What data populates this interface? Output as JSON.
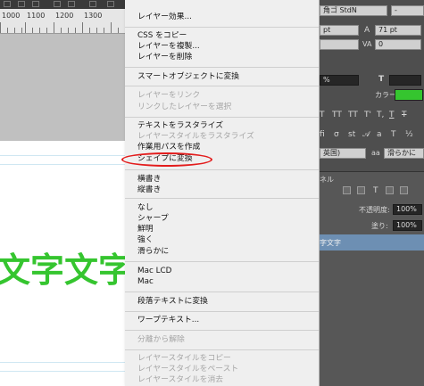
{
  "canvas": {
    "ruler_labels": [
      "1000",
      "1100",
      "1200",
      "1300"
    ],
    "big_text": "文字文字"
  },
  "menu": {
    "items": [
      {
        "label": "レイヤー効果...",
        "enabled": true
      },
      {
        "label": "CSS をコピー",
        "enabled": true
      },
      {
        "label": "レイヤーを複製...",
        "enabled": true
      },
      {
        "label": "レイヤーを削除",
        "enabled": true
      },
      {
        "label": "スマートオブジェクトに変換",
        "enabled": true
      },
      {
        "label": "レイヤーをリンク",
        "enabled": false
      },
      {
        "label": "リンクしたレイヤーを選択",
        "enabled": false
      },
      {
        "label": "テキストをラスタライズ",
        "enabled": true
      },
      {
        "label": "レイヤースタイルをラスタライズ",
        "enabled": false
      },
      {
        "label": "作業用パスを作成",
        "enabled": true
      },
      {
        "label": "シェイプに変換",
        "enabled": true,
        "highlighted": true
      },
      {
        "label": "横書き",
        "enabled": true
      },
      {
        "label": "縦書き",
        "enabled": true
      },
      {
        "label": "なし",
        "enabled": true
      },
      {
        "label": "シャープ",
        "enabled": true
      },
      {
        "label": "鮮明",
        "enabled": true
      },
      {
        "label": "強く",
        "enabled": true
      },
      {
        "label": "滑らかに",
        "enabled": true
      },
      {
        "label": "Mac LCD",
        "enabled": true
      },
      {
        "label": "Mac",
        "enabled": true
      },
      {
        "label": "段落テキストに変換",
        "enabled": true
      },
      {
        "label": "ワープテキスト...",
        "enabled": true
      },
      {
        "label": "分離から解除",
        "enabled": false
      },
      {
        "label": "レイヤースタイルをコピー",
        "enabled": false
      },
      {
        "label": "レイヤースタイルをペースト",
        "enabled": false
      },
      {
        "label": "レイヤースタイルを消去",
        "enabled": false
      }
    ],
    "highlight_color": "#e31c1c"
  },
  "right_panel": {
    "font_family": "角ゴ StdN",
    "font_style": "-",
    "font_size": "pt",
    "leading": "71 pt",
    "tracking_label": "VA",
    "tracking": "0",
    "percent_1": "%",
    "color_label": "カラー:",
    "color_swatch": "#35c52f",
    "aa_language": "英国)",
    "aa_mode_label": "aa",
    "aa_mode": "滑らかに",
    "layers_tab": "ネル",
    "opacity_label": "不透明度:",
    "opacity": "100%",
    "fill_label": "塗り:",
    "fill": "100%",
    "layer_name": "字文字"
  }
}
